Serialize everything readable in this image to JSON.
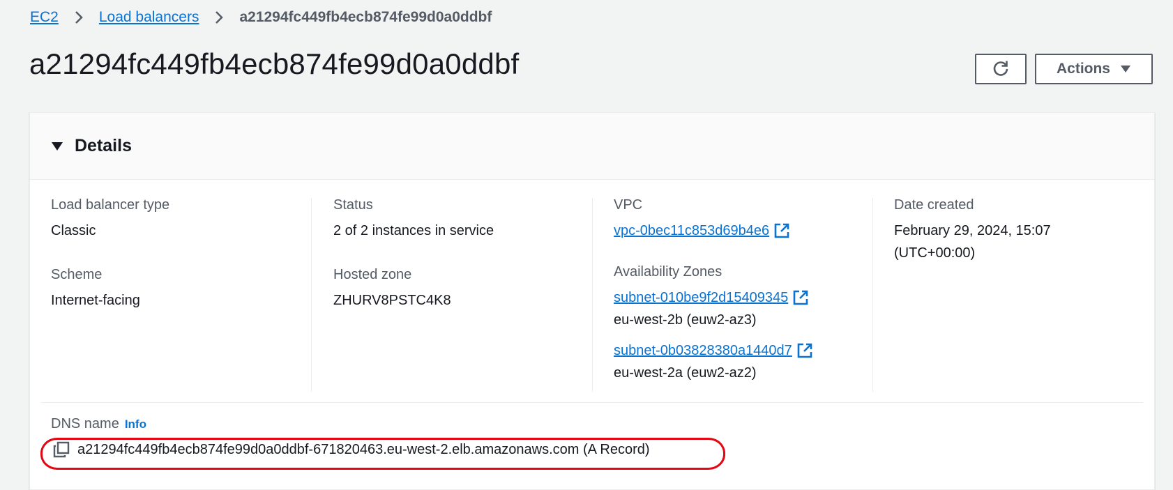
{
  "breadcrumb": {
    "items": [
      "EC2",
      "Load balancers"
    ],
    "current": "a21294fc449fb4ecb874fe99d0a0ddbf"
  },
  "page": {
    "title": "a21294fc449fb4ecb874fe99d0a0ddbf"
  },
  "toolbar": {
    "refresh_icon": "refresh-icon",
    "actions_label": "Actions"
  },
  "details": {
    "title": "Details",
    "load_balancer_type_label": "Load balancer type",
    "load_balancer_type": "Classic",
    "scheme_label": "Scheme",
    "scheme": "Internet-facing",
    "status_label": "Status",
    "status": "2 of 2 instances in service",
    "hosted_zone_label": "Hosted zone",
    "hosted_zone": "ZHURV8PSTC4K8",
    "vpc_label": "VPC",
    "vpc": "vpc-0bec11c853d69b4e6",
    "az_label": "Availability Zones",
    "subnets": [
      {
        "id": "subnet-010be9f2d15409345",
        "zone": "eu-west-2b (euw2-az3)"
      },
      {
        "id": "subnet-0b03828380a1440d7",
        "zone": "eu-west-2a (euw2-az2)"
      }
    ],
    "date_created_label": "Date created",
    "date_created_line1": "February 29, 2024, 15:07",
    "date_created_line2": "(UTC+00:00)",
    "dns_label": "DNS name",
    "info_label": "Info",
    "dns_name": "a21294fc449fb4ecb874fe99d0a0ddbf-671820463.eu-west-2.elb.amazonaws.com (A Record)"
  },
  "colors": {
    "link": "#0972d3",
    "highlight": "#e30613",
    "background": "#f2f3f3"
  }
}
